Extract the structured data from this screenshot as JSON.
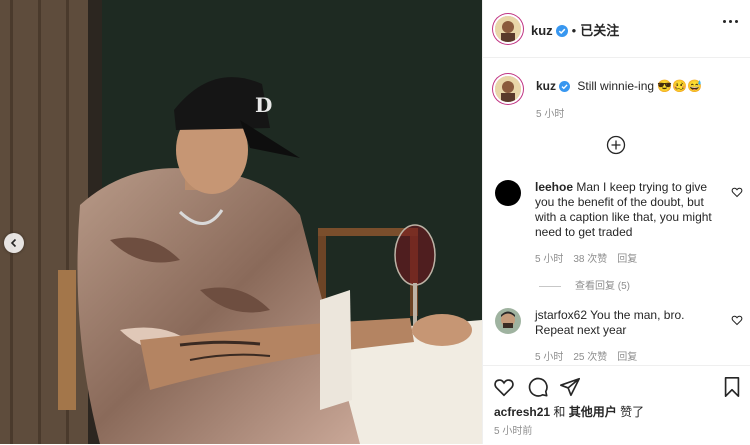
{
  "post": {
    "username": "kuz",
    "follow_state": "已关注",
    "separator": "•",
    "caption": {
      "username": "kuz",
      "text": "Still winnie-ing 😎🥴😅",
      "time": "5 小时"
    },
    "comments": [
      {
        "username": "leehoe",
        "text": "Man I keep trying to give you the benefit of the doubt, but with a caption like that, you might need to get traded",
        "time": "5 小时",
        "likes": "38 次赞",
        "reply": "回复",
        "view_replies": "查看回复 (5)"
      },
      {
        "username": "jstarfox62",
        "text": "You the man, bro. Repeat next year",
        "time": "5 小时",
        "likes": "25 次赞",
        "reply": "回复"
      }
    ],
    "likes_line": {
      "user": "acfresh21",
      "connector": " 和 ",
      "others": "其他用户",
      "suffix": " 赞了"
    },
    "post_time": "5 小时前"
  },
  "icons": {
    "verified": "verified-badge-icon",
    "more": "more-options-icon",
    "load_more": "plus-circle-icon",
    "like": "heart-icon",
    "comment": "comment-icon",
    "share": "share-icon",
    "save": "bookmark-icon",
    "prev": "chevron-left-icon"
  },
  "colors": {
    "verified": "#3897f0",
    "secondary_text": "#8e8e8e",
    "border": "#efefef"
  }
}
